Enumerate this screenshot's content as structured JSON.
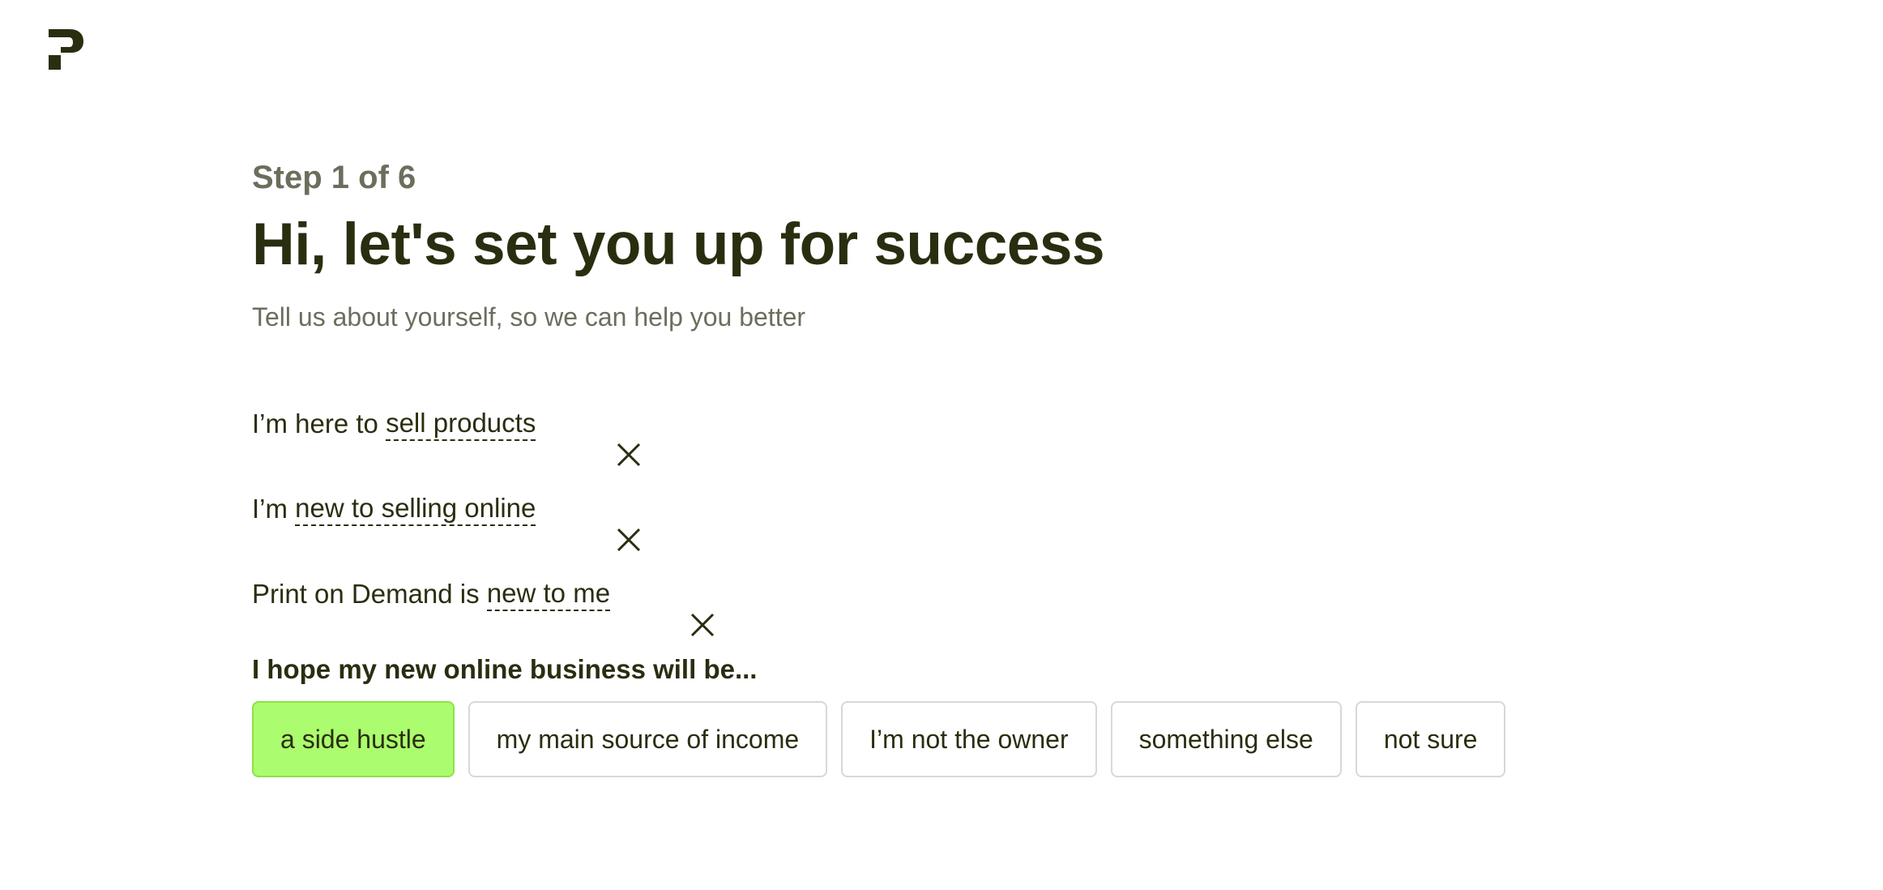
{
  "colors": {
    "brand_dark": "#2a2e10",
    "muted": "#6b6e5c",
    "selected_bg": "#abfc6e",
    "option_border": "#d8d9d2"
  },
  "header": {
    "logo_icon": "printful-p-logo"
  },
  "step": "Step 1 of 6",
  "title": "Hi, let's set you up for success",
  "subtitle": "Tell us about yourself, so we can help you better",
  "statements": [
    {
      "prefix": "I’m here to ",
      "choice": "sell products",
      "suffix": "",
      "remove_icon": "close-icon"
    },
    {
      "prefix": "I’m ",
      "choice": "new to selling online",
      "suffix": "",
      "remove_icon": "close-icon"
    },
    {
      "prefix": "Print on Demand is ",
      "choice": "new to me",
      "suffix": "",
      "remove_icon": "close-icon"
    }
  ],
  "question": "I hope my new online business will be...",
  "options": [
    {
      "label": "a side hustle",
      "selected": true
    },
    {
      "label": "my main source of income",
      "selected": false
    },
    {
      "label": "I’m not the owner",
      "selected": false
    },
    {
      "label": "something else",
      "selected": false
    },
    {
      "label": "not sure",
      "selected": false
    }
  ]
}
